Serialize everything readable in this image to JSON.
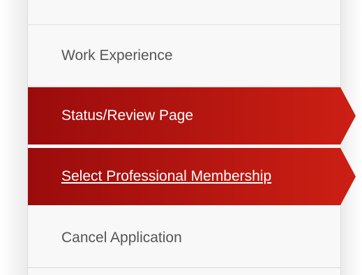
{
  "colors": {
    "active_dark": "#9a0c0c",
    "active_light": "#cc1f14",
    "inactive_bg": "#f8f8f8",
    "inactive_text": "#555555"
  },
  "nav": {
    "items": [
      {
        "label": "Work Experience",
        "active": false
      },
      {
        "label": "Status/Review Page",
        "active": true
      },
      {
        "label": "Select Professional Membership",
        "active": true,
        "link": true
      },
      {
        "label": "Cancel Application",
        "active": false
      }
    ]
  }
}
